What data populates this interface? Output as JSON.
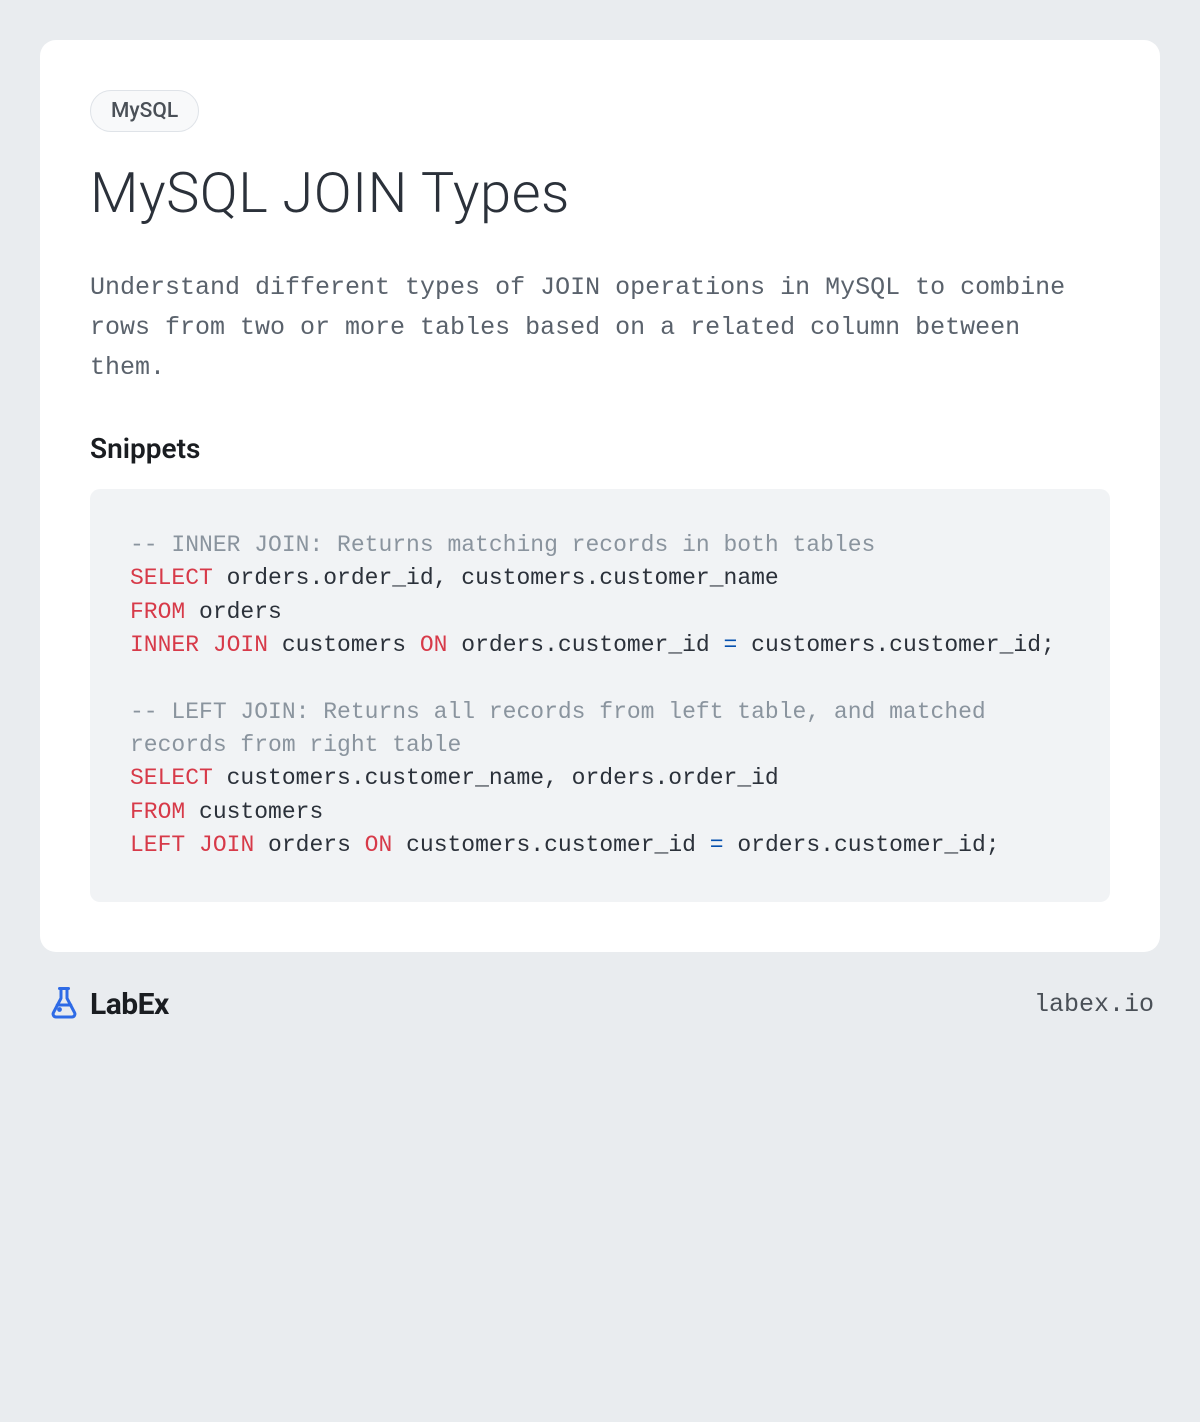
{
  "tag": "MySQL",
  "title": "MySQL JOIN Types",
  "description": "Understand different types of JOIN operations in MySQL to combine rows from two or more tables based on a related column between them.",
  "snippets_heading": "Snippets",
  "code": {
    "tokens": [
      {
        "t": "-- INNER JOIN: Returns matching records in both tables",
        "c": "tok-comment"
      },
      {
        "t": "\n"
      },
      {
        "t": "SELECT",
        "c": "tok-keyword"
      },
      {
        "t": " orders.order_id, customers.customer_name\n"
      },
      {
        "t": "FROM",
        "c": "tok-keyword"
      },
      {
        "t": " orders\n"
      },
      {
        "t": "INNER",
        "c": "tok-keyword"
      },
      {
        "t": " "
      },
      {
        "t": "JOIN",
        "c": "tok-keyword"
      },
      {
        "t": " customers "
      },
      {
        "t": "ON",
        "c": "tok-keyword"
      },
      {
        "t": " orders.customer_id "
      },
      {
        "t": "=",
        "c": "tok-op"
      },
      {
        "t": " customers.customer_id;\n\n"
      },
      {
        "t": "-- LEFT JOIN: Returns all records from left table, and matched records from right table",
        "c": "tok-comment"
      },
      {
        "t": "\n"
      },
      {
        "t": "SELECT",
        "c": "tok-keyword"
      },
      {
        "t": " customers.customer_name, orders.order_id\n"
      },
      {
        "t": "FROM",
        "c": "tok-keyword"
      },
      {
        "t": " customers\n"
      },
      {
        "t": "LEFT",
        "c": "tok-keyword"
      },
      {
        "t": " "
      },
      {
        "t": "JOIN",
        "c": "tok-keyword"
      },
      {
        "t": " orders "
      },
      {
        "t": "ON",
        "c": "tok-keyword"
      },
      {
        "t": " customers.customer_id "
      },
      {
        "t": "=",
        "c": "tok-op"
      },
      {
        "t": " orders.customer_id;"
      }
    ]
  },
  "logo_text": "LabEx",
  "site": "labex.io"
}
